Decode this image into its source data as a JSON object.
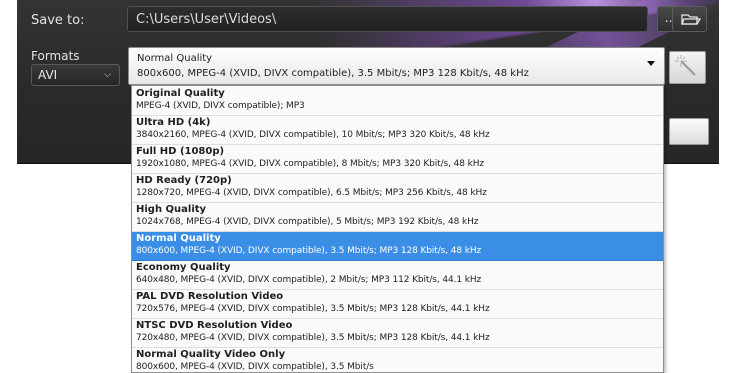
{
  "save_to": {
    "label": "Save to:",
    "path": "C:\\Users\\User\\Videos\\",
    "browse_label": "...",
    "folder_icon": "folder-open-icon"
  },
  "formats": {
    "label": "Formats",
    "selected": "AVI"
  },
  "quality": {
    "selected_name": "Normal Quality",
    "selected_desc": "800x600, MPEG-4 (XVID, DIVX compatible), 3.5 Mbit/s; MP3 128 Kbit/s, 48 kHz",
    "wand_icon": "magic-wand-icon"
  },
  "colors": {
    "panel": "#2b2b2b",
    "highlight": "#3a8ee6"
  },
  "options": [
    {
      "name": "Original Quality",
      "desc": "MPEG-4 (XVID, DIVX compatible); MP3"
    },
    {
      "name": "Ultra HD (4k)",
      "desc": "3840x2160, MPEG-4 (XVID, DIVX compatible), 10 Mbit/s; MP3 320 Kbit/s, 48 kHz"
    },
    {
      "name": "Full HD (1080p)",
      "desc": "1920x1080, MPEG-4 (XVID, DIVX compatible), 8 Mbit/s; MP3 320 Kbit/s, 48 kHz"
    },
    {
      "name": "HD Ready (720p)",
      "desc": "1280x720, MPEG-4 (XVID, DIVX compatible), 6.5 Mbit/s; MP3 256 Kbit/s, 48 kHz"
    },
    {
      "name": "High Quality",
      "desc": "1024x768, MPEG-4 (XVID, DIVX compatible), 5 Mbit/s; MP3 192 Kbit/s, 48 kHz"
    },
    {
      "name": "Normal Quality",
      "desc": "800x600, MPEG-4 (XVID, DIVX compatible), 3.5 Mbit/s; MP3 128 Kbit/s, 48 kHz",
      "selected": true
    },
    {
      "name": "Economy Quality",
      "desc": "640x480, MPEG-4 (XVID, DIVX compatible), 2 Mbit/s; MP3 112 Kbit/s, 44.1 kHz"
    },
    {
      "name": "PAL DVD Resolution Video",
      "desc": "720x576, MPEG-4 (XVID, DIVX compatible), 3.5 Mbit/s; MP3 128 Kbit/s, 44.1 kHz"
    },
    {
      "name": "NTSC DVD Resolution Video",
      "desc": "720x480, MPEG-4 (XVID, DIVX compatible), 3.5 Mbit/s; MP3 128 Kbit/s, 44.1 kHz"
    },
    {
      "name": "Normal Quality Video Only",
      "desc": "800x600, MPEG-4 (XVID, DIVX compatible), 3.5 Mbit/s"
    }
  ]
}
